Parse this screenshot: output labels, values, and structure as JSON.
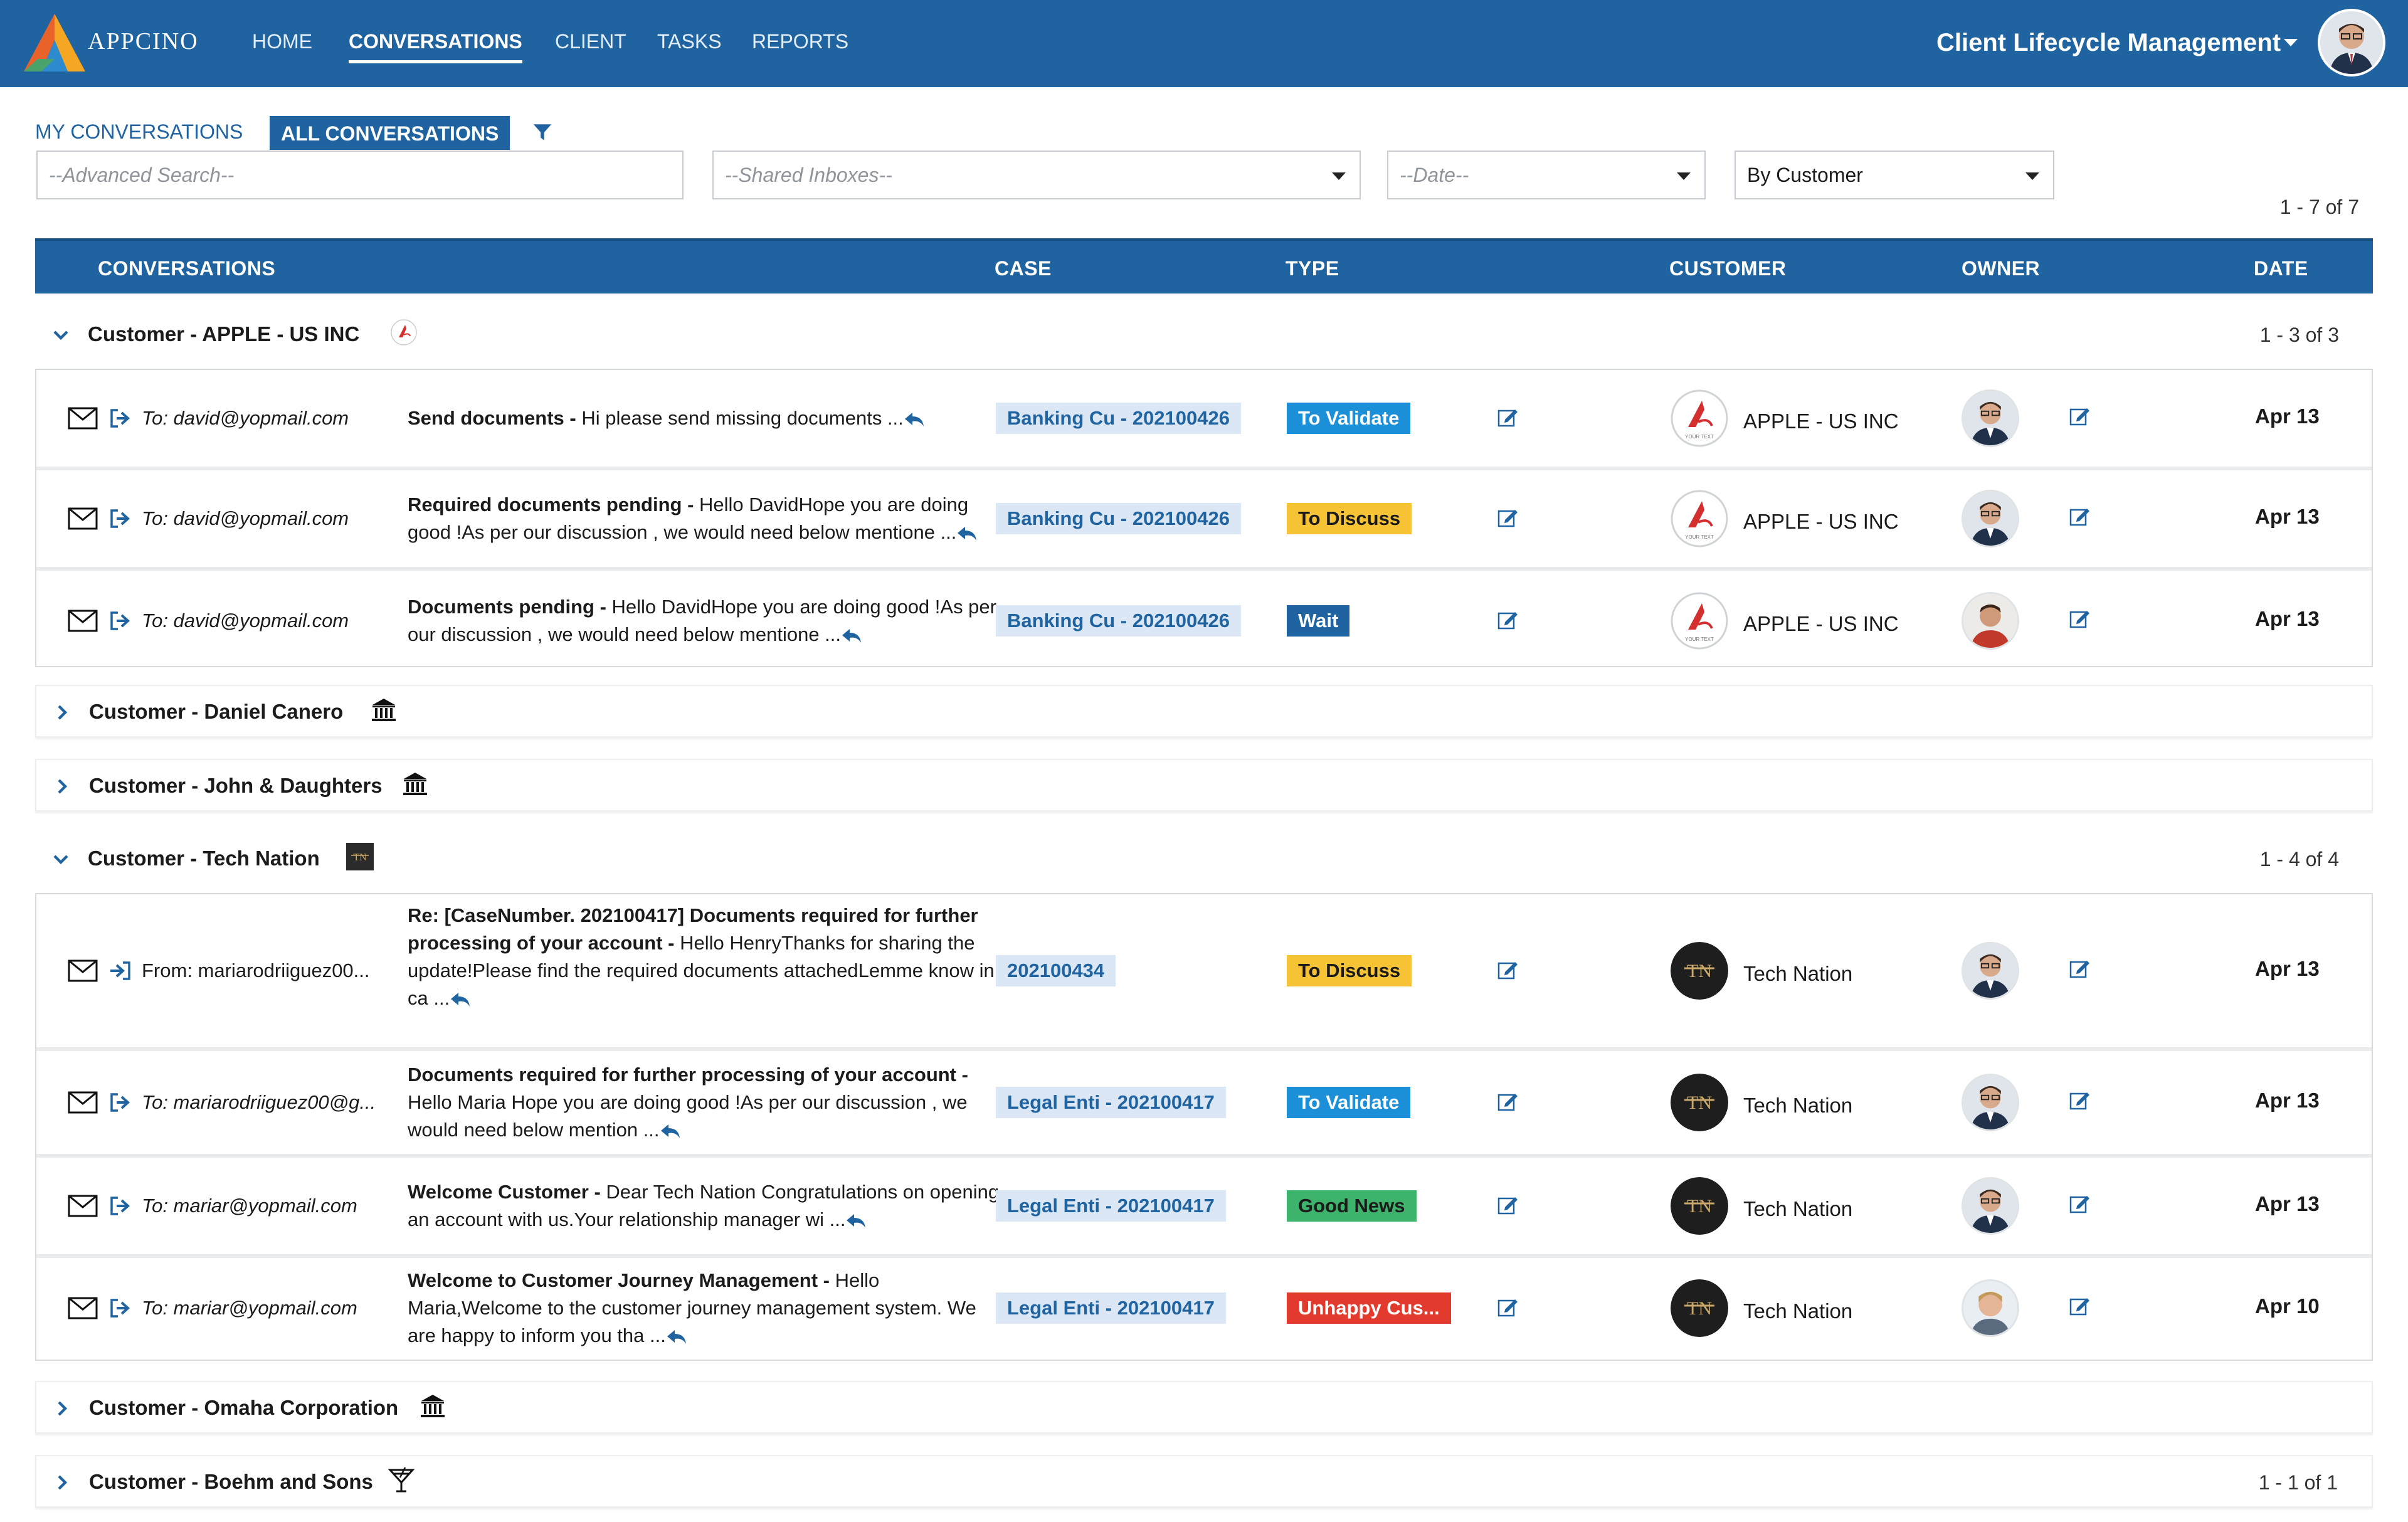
{
  "nav": {
    "brand": "APPCINO",
    "items": [
      "HOME",
      "CONVERSATIONS",
      "CLIENT",
      "TASKS",
      "REPORTS"
    ],
    "active": "CONVERSATIONS",
    "app_title": "Client Lifecycle Management"
  },
  "toolbar": {
    "tab_my": "MY CONVERSATIONS",
    "tab_all": "ALL CONVERSATIONS",
    "search_placeholder": "--Advanced Search--",
    "inbox_placeholder": "--Shared Inboxes--",
    "date_placeholder": "--Date--",
    "group_by": "By Customer",
    "pager": "1 - 7  of  7"
  },
  "columns": {
    "conversations": "CONVERSATIONS",
    "case": "CASE",
    "type": "TYPE",
    "customer": "CUSTOMER",
    "owner": "OWNER",
    "date": "DATE"
  },
  "type_colors": {
    "To Validate": {
      "bg": "#1b8fd8",
      "fg": "#ffffff"
    },
    "To Discuss": {
      "bg": "#f5c334",
      "fg": "#1b1b1b"
    },
    "Wait": {
      "bg": "#1f63a0",
      "fg": "#ffffff"
    },
    "Good News": {
      "bg": "#3db36b",
      "fg": "#1b1b1b"
    },
    "Unhappy Cus...": {
      "bg": "#e23b2e",
      "fg": "#ffffff"
    }
  },
  "groups": [
    {
      "title": "Customer - APPLE - US INC",
      "icon": "company-logo-icon",
      "expanded": true,
      "pager": "1 - 3  of  3",
      "rows": [
        {
          "direction": "to",
          "address": "To: david@yopmail.com",
          "subject_bold": "Send documents - ",
          "subject_text": "Hi please send missing documents ...",
          "case": "Banking Cu - 202100426",
          "type": "To Validate",
          "customer": "APPLE - US INC",
          "date": "Apr 13"
        },
        {
          "direction": "to",
          "address": "To: david@yopmail.com",
          "subject_bold": "Required documents pending - ",
          "subject_text": "Hello DavidHope you are doing good !As per our discussion , we would need below mentione ...",
          "case": "Banking Cu - 202100426",
          "type": "To Discuss",
          "customer": "APPLE - US INC",
          "date": "Apr 13"
        },
        {
          "direction": "to",
          "address": "To: david@yopmail.com",
          "subject_bold": "Documents pending - ",
          "subject_text": "Hello DavidHope you are doing good !As per our discussion , we would need below mentione ...",
          "case": "Banking Cu - 202100426",
          "type": "Wait",
          "customer": "APPLE - US INC",
          "date": "Apr 13"
        }
      ]
    },
    {
      "title": "Customer - Daniel Canero",
      "icon": "bank-icon",
      "expanded": false
    },
    {
      "title": "Customer - John & Daughters",
      "icon": "bank-icon",
      "expanded": false
    },
    {
      "title": "Customer - Tech Nation",
      "icon": "tech-nation-logo-icon",
      "expanded": true,
      "pager": "1 - 4  of  4",
      "rows": [
        {
          "direction": "from",
          "address": "From: mariarodriiguez00...",
          "subject_bold": "Re: [CaseNumber. 202100417] Documents required for further processing of your account - ",
          "subject_text": "Hello HenryThanks for sharing the update!Please find the required documents attachedLemme know in ca ...",
          "case": "202100434",
          "type": "To Discuss",
          "customer": "Tech Nation",
          "date": "Apr 13"
        },
        {
          "direction": "to",
          "address": "To: mariarodriiguez00@g...",
          "subject_bold": "Documents required for further processing of your account - ",
          "subject_text": "Hello Maria Hope you are doing good !As per our discussion , we would need below mention ...",
          "case": "Legal Enti - 202100417",
          "type": "To Validate",
          "customer": "Tech Nation",
          "date": "Apr 13"
        },
        {
          "direction": "to",
          "address": "To: mariar@yopmail.com",
          "subject_bold": "Welcome Customer - ",
          "subject_text": "Dear Tech Nation Congratulations on opening an account with us.Your relationship manager wi ...",
          "case": "Legal Enti - 202100417",
          "type": "Good News",
          "customer": "Tech Nation",
          "date": "Apr 13"
        },
        {
          "direction": "to",
          "address": "To: mariar@yopmail.com",
          "subject_bold": "Welcome to Customer Journey Management - ",
          "subject_text": "Hello Maria,Welcome to the customer journey management system. We are happy to inform you tha ...",
          "case": "Legal Enti - 202100417",
          "type": "Unhappy Cus...",
          "customer": "Tech Nation",
          "date": "Apr 10"
        }
      ]
    },
    {
      "title": "Customer - Omaha Corporation",
      "icon": "bank-icon",
      "expanded": false
    },
    {
      "title": "Customer - Boehm and Sons",
      "icon": "cocktail-icon",
      "expanded": false,
      "pager": "1 - 1  of  1"
    }
  ]
}
